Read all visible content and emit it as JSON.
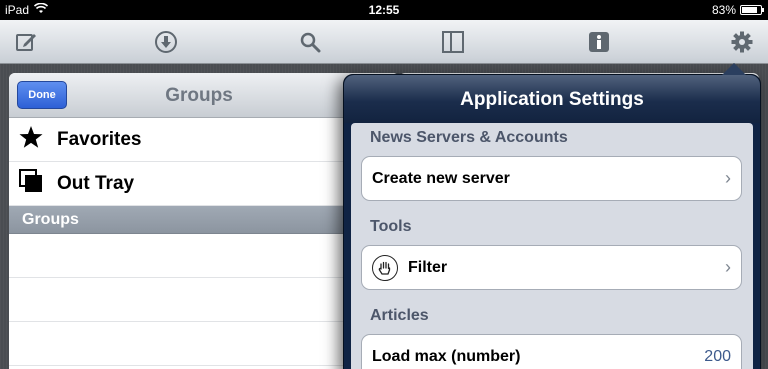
{
  "status_bar": {
    "device": "iPad",
    "time": "12:55",
    "battery": "83%",
    "battery_level": 0.83
  },
  "toolbar": {
    "icons": [
      "compose-icon",
      "download-icon",
      "search-icon",
      "split-view-icon",
      "info-icon",
      "settings-gear-icon"
    ]
  },
  "left_panel": {
    "done_label": "Done",
    "title": "Groups",
    "items": [
      {
        "label": "Favorites",
        "icon": "star-icon"
      },
      {
        "label": "Out Tray",
        "icon": "stacked-pages-icon"
      }
    ],
    "section_header": "Groups"
  },
  "popover": {
    "title": "Application Settings",
    "sections": [
      {
        "header": "News Servers & Accounts",
        "cells": [
          {
            "label": "Create new server"
          }
        ]
      },
      {
        "header": "Tools",
        "cells": [
          {
            "label": "Filter",
            "icon": "hand-icon"
          }
        ]
      },
      {
        "header": "Articles",
        "cells": [
          {
            "label": "Load max (number)",
            "value": "200"
          }
        ]
      }
    ]
  }
}
